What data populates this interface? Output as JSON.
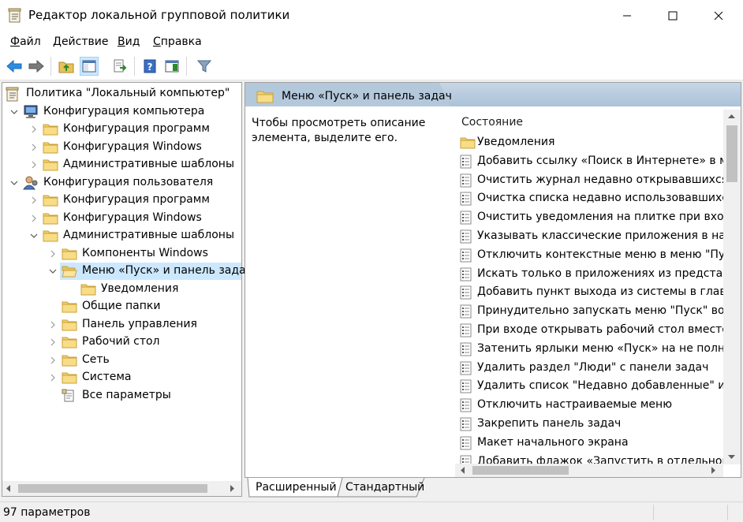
{
  "window": {
    "title": "Редактор локальной групповой политики"
  },
  "menu": {
    "items": [
      {
        "label": "Файл",
        "underline": "Ф",
        "rest": "айл"
      },
      {
        "label": "Действие",
        "underline": "Д",
        "rest": "ействие"
      },
      {
        "label": "Вид",
        "underline": "В",
        "rest": "ид"
      },
      {
        "label": "Справка",
        "underline": "С",
        "rest": "правка"
      }
    ]
  },
  "toolbar": {
    "icons": [
      "back-arrow-icon",
      "forward-arrow-icon",
      "up-folder-icon",
      "show-hide-tree-icon",
      "export-list-icon",
      "help-icon",
      "show-hide-action-pane-icon",
      "filter-icon"
    ]
  },
  "tree": {
    "items": [
      {
        "label": "Политика \"Локальный компьютер\"",
        "icon": "policy-icon",
        "indent": 0,
        "chevron": ""
      },
      {
        "label": "Конфигурация компьютера",
        "icon": "computer-icon",
        "indent": 1,
        "chevron": "v"
      },
      {
        "label": "Конфигурация программ",
        "icon": "folder-icon",
        "indent": 2,
        "chevron": ">"
      },
      {
        "label": "Конфигурация Windows",
        "icon": "folder-icon",
        "indent": 2,
        "chevron": ">"
      },
      {
        "label": "Административные шаблоны",
        "icon": "folder-icon",
        "indent": 2,
        "chevron": ">"
      },
      {
        "label": "Конфигурация пользователя",
        "icon": "user-icon",
        "indent": 1,
        "chevron": "v"
      },
      {
        "label": "Конфигурация программ",
        "icon": "folder-icon",
        "indent": 2,
        "chevron": ">"
      },
      {
        "label": "Конфигурация Windows",
        "icon": "folder-icon",
        "indent": 2,
        "chevron": ">"
      },
      {
        "label": "Административные шаблоны",
        "icon": "folder-icon",
        "indent": 2,
        "chevron": "v"
      },
      {
        "label": "Компоненты Windows",
        "icon": "folder-icon",
        "indent": 3,
        "chevron": ">"
      },
      {
        "label": "Меню «Пуск» и панель задач",
        "icon": "folder-open-icon",
        "indent": 3,
        "chevron": "v",
        "selected": true
      },
      {
        "label": "Уведомления",
        "icon": "folder-icon",
        "indent": 4,
        "chevron": ""
      },
      {
        "label": "Общие папки",
        "icon": "folder-icon",
        "indent": 3,
        "chevron": ""
      },
      {
        "label": "Панель управления",
        "icon": "folder-icon",
        "indent": 3,
        "chevron": ">"
      },
      {
        "label": "Рабочий стол",
        "icon": "folder-icon",
        "indent": 3,
        "chevron": ">"
      },
      {
        "label": "Сеть",
        "icon": "folder-icon",
        "indent": 3,
        "chevron": ">"
      },
      {
        "label": "Система",
        "icon": "folder-icon",
        "indent": 3,
        "chevron": ">"
      },
      {
        "label": "Все параметры",
        "icon": "all-settings-icon",
        "indent": 3,
        "chevron": ""
      }
    ]
  },
  "content": {
    "title": "Меню «Пуск» и панель задач",
    "description": "Чтобы просмотреть описание элемента, выделите его.",
    "column_header": "Состояние",
    "rows": [
      {
        "label": "Уведомления",
        "icon": "folder-icon"
      },
      {
        "label": "Добавить ссылку «Поиск в Интернете» в меню",
        "icon": "setting-icon"
      },
      {
        "label": "Очистить журнал недавно открывавшихся док",
        "icon": "setting-icon"
      },
      {
        "label": "Очистка списка недавно использовавшихся пр",
        "icon": "setting-icon"
      },
      {
        "label": "Очистить уведомления на плитке при входе",
        "icon": "setting-icon"
      },
      {
        "label": "Указывать классические приложения в начале",
        "icon": "setting-icon"
      },
      {
        "label": "Отключить контекстные меню в меню \"Пуск\"",
        "icon": "setting-icon"
      },
      {
        "label": "Искать только в приложениях из представлени",
        "icon": "setting-icon"
      },
      {
        "label": "Добавить пункт выхода из системы в главное м",
        "icon": "setting-icon"
      },
      {
        "label": "Принудительно запускать меню \"Пуск\" во весь",
        "icon": "setting-icon"
      },
      {
        "label": "При входе открывать рабочий стол вместо нач",
        "icon": "setting-icon"
      },
      {
        "label": "Затенить ярлыки меню «Пуск» на не полность",
        "icon": "setting-icon"
      },
      {
        "label": "Удалить раздел \"Люди\" с панели задач",
        "icon": "setting-icon"
      },
      {
        "label": "Удалить список \"Недавно добавленные\" из мен",
        "icon": "setting-icon"
      },
      {
        "label": "Отключить настраиваемые меню",
        "icon": "setting-icon"
      },
      {
        "label": "Закрепить панель задач",
        "icon": "setting-icon"
      },
      {
        "label": "Макет начального экрана",
        "icon": "setting-icon"
      },
      {
        "label": "Добавить флажок «Запустить в отдельной обл",
        "icon": "setting-icon"
      }
    ]
  },
  "tabs": {
    "extended": "Расширенный",
    "standard": "Стандартный"
  },
  "status": {
    "text": "97 параметров"
  }
}
